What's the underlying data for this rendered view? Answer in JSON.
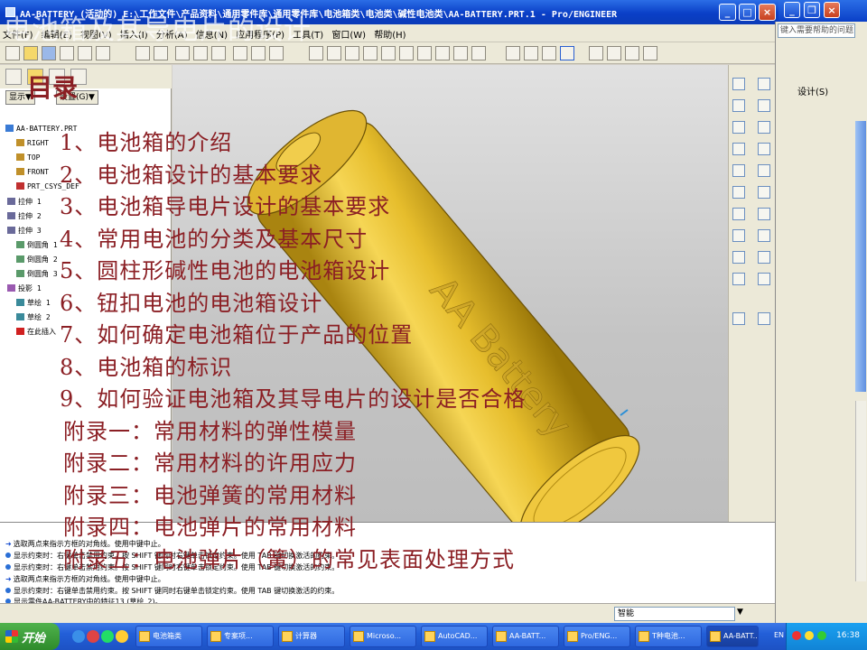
{
  "window": {
    "title": "AA-BATTERY (活动的) E:\\工作文件\\产品资料\\通用零件库\\通用零件库\\电池箱类\\电池类\\碱性电池类\\AA-BATTERY.PRT.1 - Pro/ENGINEER",
    "min_label": "_",
    "max_label": "□",
    "close_label": "×"
  },
  "menu": [
    "文件(F)",
    "编辑(E)",
    "视图(V)",
    "插入(I)",
    "分析(A)",
    "信息(N)",
    "应用程序(P)",
    "工具(T)",
    "窗口(W)",
    "帮助(H)"
  ],
  "tree": {
    "show_label": "显示▼",
    "settings_label": "设置(G)▼",
    "items": [
      {
        "label": "AA-BATTERY.PRT",
        "icon": "part-icon"
      },
      {
        "label": "RIGHT",
        "icon": "datum-plane-icon"
      },
      {
        "label": "TOP",
        "icon": "datum-plane-icon"
      },
      {
        "label": "FRONT",
        "icon": "datum-plane-icon"
      },
      {
        "label": "PRT_CSYS_DEF",
        "icon": "csys-icon"
      },
      {
        "label": "拉伸 1",
        "icon": "extrude-icon"
      },
      {
        "label": "拉伸 2",
        "icon": "extrude-icon"
      },
      {
        "label": "拉伸 3",
        "icon": "extrude-icon"
      },
      {
        "label": "倒圆角 1",
        "icon": "round-icon"
      },
      {
        "label": "倒圆角 2",
        "icon": "round-icon"
      },
      {
        "label": "倒圆角 3",
        "icon": "round-icon"
      },
      {
        "label": "投影 1",
        "icon": "projection-icon"
      },
      {
        "label": "草绘 1",
        "icon": "sketch-icon"
      },
      {
        "label": "草绘 2",
        "icon": "sketch-icon"
      },
      {
        "label": "在此插入",
        "icon": "insert-arrow-icon"
      }
    ]
  },
  "messages": [
    "选取两点来指示方框的对角线。使用中键中止。",
    "显示约束时：右键单击禁用约束。按 SHIFT 键同时右键单击锁定约束。使用 TAB 键切换激活的约束。",
    "显示约束时：右键单击禁用约束。按 SHIFT 键同时右键单击锁定约束。使用 TAB 键切换激活的约束。",
    "选取两点来指示方框的对角线。使用中键中止。",
    "显示约束时：右键单击禁用约束。按 SHIFT 键同时右键单击锁定约束。使用 TAB 键切换激活的约束。",
    "显示零件AA-BATTERY中的特征13 (草绘_2)。"
  ],
  "filter": {
    "value": "智能"
  },
  "battery": {
    "label": "AA Battery",
    "color": "#e8c23a"
  },
  "right_window": {
    "question_placeholder": "键入需要帮助的问题",
    "design_label": "设计(S)"
  },
  "taskbar": {
    "start_label": "开始",
    "buttons": [
      "电池箱类",
      "专案项...",
      "计算器",
      "Microso...",
      "AutoCAD...",
      "AA-BATT...",
      "Pro/ENG...",
      "T种电池...",
      "AA-BATT..."
    ],
    "lang": "EN",
    "clock": "16:38"
  },
  "slide": {
    "title": "电池箱及其导电片的设计",
    "subtitle": "目录",
    "toc": [
      "1、电池箱的介绍",
      "2、电池箱设计的基本要求",
      "3、电池箱导电片设计的基本要求",
      "4、常用电池的分类及基本尺寸",
      "5、圆柱形碱性电池的电池箱设计",
      "6、钮扣电池的电池箱设计",
      "7、如何确定电池箱位于产品的位置",
      "8、电池箱的标识",
      "9、如何验证电池箱及其导电片的设计是否合格",
      "附录一：常用材料的弹性模量",
      "附录二：常用材料的许用应力",
      "附录三：电池弹簧的常用材料",
      "附录四：电池弹片的常用材料",
      "附录五：电池弹片（簧）的常见表面处理方式"
    ],
    "text_color": "#8b1f24"
  }
}
